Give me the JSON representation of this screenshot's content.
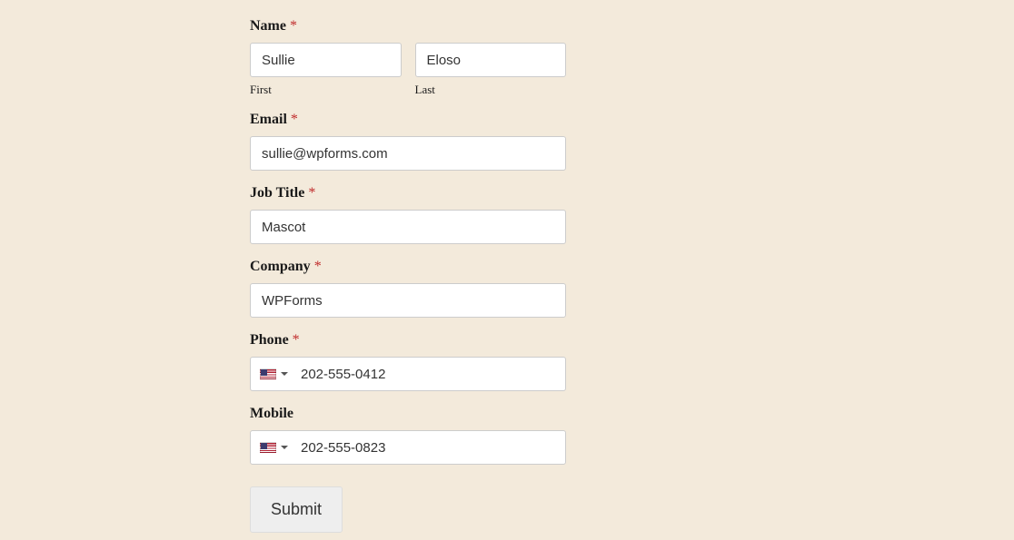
{
  "fields": {
    "name": {
      "label": "Name",
      "required": "*",
      "first_value": "Sullie",
      "first_sublabel": "First",
      "last_value": "Eloso",
      "last_sublabel": "Last"
    },
    "email": {
      "label": "Email",
      "required": "*",
      "value": "sullie@wpforms.com"
    },
    "job_title": {
      "label": "Job Title",
      "required": "*",
      "value": "Mascot"
    },
    "company": {
      "label": "Company",
      "required": "*",
      "value": "WPForms"
    },
    "phone": {
      "label": "Phone",
      "required": "*",
      "value": "202-555-0412",
      "country": "US"
    },
    "mobile": {
      "label": "Mobile",
      "value": "202-555-0823",
      "country": "US"
    }
  },
  "submit_label": "Submit"
}
